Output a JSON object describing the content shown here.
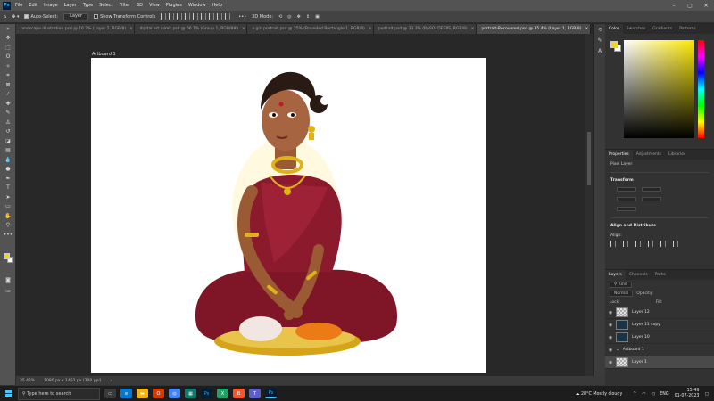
{
  "menu": {
    "items": [
      "File",
      "Edit",
      "Image",
      "Layer",
      "Type",
      "Select",
      "Filter",
      "3D",
      "View",
      "Plugins",
      "Window",
      "Help"
    ]
  },
  "options_bar": {
    "auto_select_label": "Auto-Select:",
    "auto_select_value": "Layer",
    "transform_label": "Show Transform Controls"
  },
  "tabs": [
    {
      "label": "landscape illustration.psd @ 16.2% (Layer 2, RGB/8)",
      "active": false
    },
    {
      "label": "digital art inimk.psd @ 66.7% (Group 1, RGB/8#)",
      "active": false
    },
    {
      "label": "a girl portrait.psd @ 25% (Rounded Rectangle 1, RGB/8)",
      "active": false
    },
    {
      "label": "portrait.psd @ 33.3% (RASOI DEEPS, RGB/8)",
      "active": false
    },
    {
      "label": "portrait-Recovered.psd @ 35.4% (Layer 1, RGB/8)",
      "active": true
    }
  ],
  "canvas": {
    "artboard_label": "Artboard 1"
  },
  "status_bar": {
    "zoom": "35.42%",
    "doc_info": "1080 px x 1452 px (300 ppi)"
  },
  "color_panel": {
    "tabs": [
      "Color",
      "Swatches",
      "Gradients",
      "Patterns"
    ],
    "foreground": "#f2d31c",
    "background": "#ffffff"
  },
  "properties_panel": {
    "tabs": [
      "Properties",
      "Adjustments",
      "Libraries"
    ],
    "kind": "Pixel Layer",
    "transform_label": "Transform",
    "align_label": "Align and Distribute",
    "align_sub": "Align:"
  },
  "layers_panel": {
    "tabs": [
      "Layers",
      "Channels",
      "Paths"
    ],
    "kind_filter": "Kind",
    "mode": "Normal",
    "opacity_label": "Opacity:",
    "lock_label": "Lock:",
    "fill_label": "Fill:",
    "layers": [
      {
        "name": "Layer 12",
        "thumb": "checker",
        "selected": false
      },
      {
        "name": "Layer 11 copy",
        "thumb": "dark",
        "selected": false
      },
      {
        "name": "Layer 10",
        "thumb": "dark",
        "selected": false
      },
      {
        "name": "Artboard 1",
        "thumb": "none",
        "selected": false
      },
      {
        "name": "Layer 1",
        "thumb": "checker",
        "selected": true
      }
    ]
  },
  "taskbar": {
    "search_placeholder": "Type here to search",
    "weather": "28°C  Mostly cloudy",
    "lang": "ENG",
    "time": "15:49",
    "date": "01-07-2023"
  },
  "colors": {
    "saree": "#8b1a2c",
    "skin": "#a0623c",
    "gold": "#e0b21a"
  }
}
